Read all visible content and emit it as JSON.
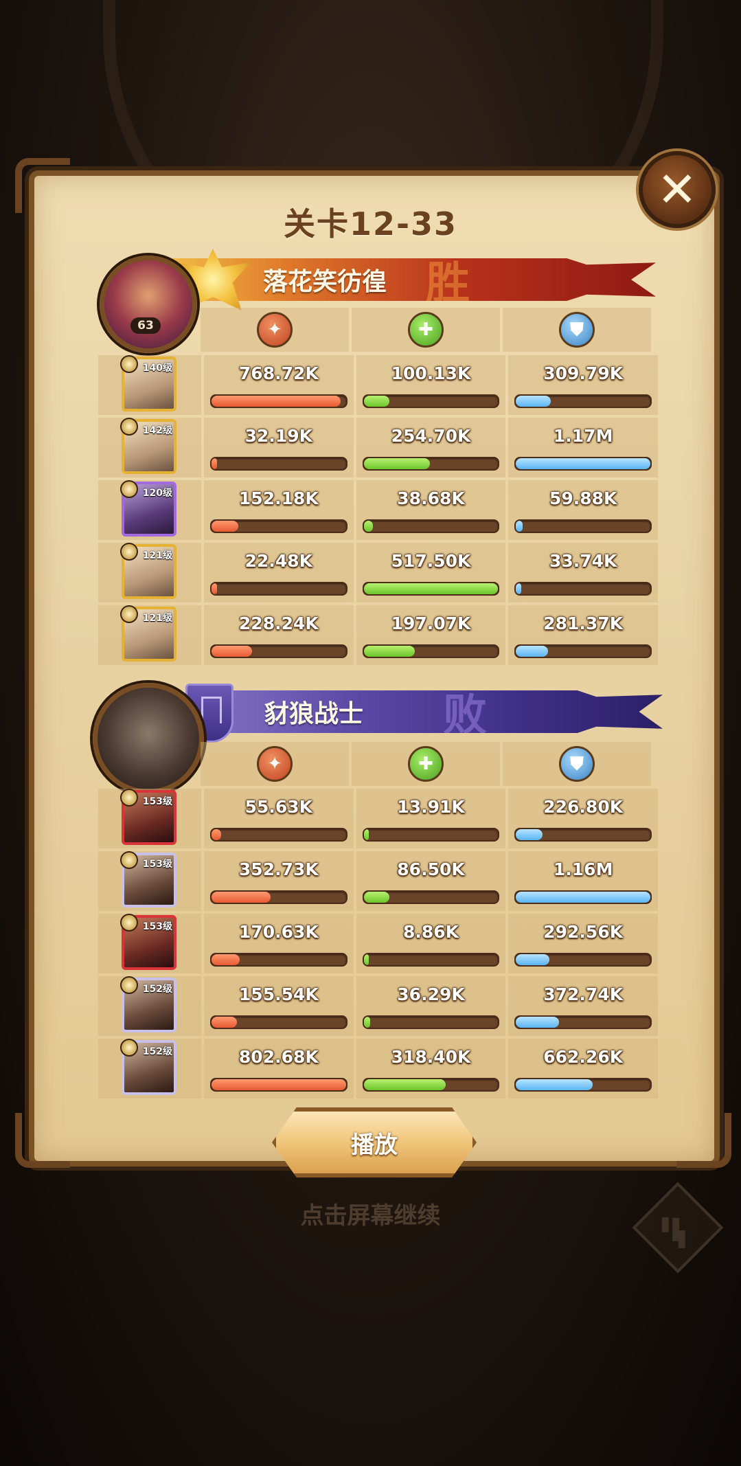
{
  "title": "关卡12-33",
  "close_icon": "close-icon",
  "winner": {
    "name": "落花笑彷徨",
    "result": "胜",
    "level": "63",
    "heroes": [
      {
        "level": "140级",
        "frame": "gold",
        "damage": "768.72K",
        "damage_pct": 0.96,
        "heal": "100.13K",
        "heal_pct": 0.19,
        "shield": "309.79K",
        "shield_pct": 0.26
      },
      {
        "level": "142级",
        "frame": "gold",
        "damage": "32.19K",
        "damage_pct": 0.04,
        "heal": "254.70K",
        "heal_pct": 0.49,
        "shield": "1.17M",
        "shield_pct": 1.0
      },
      {
        "level": "120级",
        "frame": "purple",
        "damage": "152.18K",
        "damage_pct": 0.2,
        "heal": "38.68K",
        "heal_pct": 0.07,
        "shield": "59.88K",
        "shield_pct": 0.05
      },
      {
        "level": "121级",
        "frame": "gold",
        "damage": "22.48K",
        "damage_pct": 0.03,
        "heal": "517.50K",
        "heal_pct": 1.0,
        "shield": "33.74K",
        "shield_pct": 0.03
      },
      {
        "level": "121级",
        "frame": "gold",
        "damage": "228.24K",
        "damage_pct": 0.3,
        "heal": "197.07K",
        "heal_pct": 0.38,
        "shield": "281.37K",
        "shield_pct": 0.24
      }
    ]
  },
  "loser": {
    "name": "豺狼战士",
    "result": "败",
    "heroes": [
      {
        "level": "153级",
        "frame": "red",
        "damage": "55.63K",
        "damage_pct": 0.07,
        "heal": "13.91K",
        "heal_pct": 0.04,
        "shield": "226.80K",
        "shield_pct": 0.2
      },
      {
        "level": "153级",
        "frame": "silver",
        "damage": "352.73K",
        "damage_pct": 0.44,
        "heal": "86.50K",
        "heal_pct": 0.19,
        "shield": "1.16M",
        "shield_pct": 1.0
      },
      {
        "level": "153级",
        "frame": "red",
        "damage": "170.63K",
        "damage_pct": 0.21,
        "heal": "8.86K",
        "heal_pct": 0.02,
        "shield": "292.56K",
        "shield_pct": 0.25
      },
      {
        "level": "152级",
        "frame": "silver",
        "damage": "155.54K",
        "damage_pct": 0.19,
        "heal": "36.29K",
        "heal_pct": 0.05,
        "shield": "372.74K",
        "shield_pct": 0.32
      },
      {
        "level": "152级",
        "frame": "silver",
        "damage": "802.68K",
        "damage_pct": 1.0,
        "heal": "318.40K",
        "heal_pct": 0.61,
        "shield": "662.26K",
        "shield_pct": 0.57
      }
    ]
  },
  "stat_icons": [
    "damage-icon",
    "heal-icon",
    "shield-icon"
  ],
  "play_label": "播放",
  "continue_hint": "点击屏幕继续",
  "stats_icon": "bar-chart-icon"
}
